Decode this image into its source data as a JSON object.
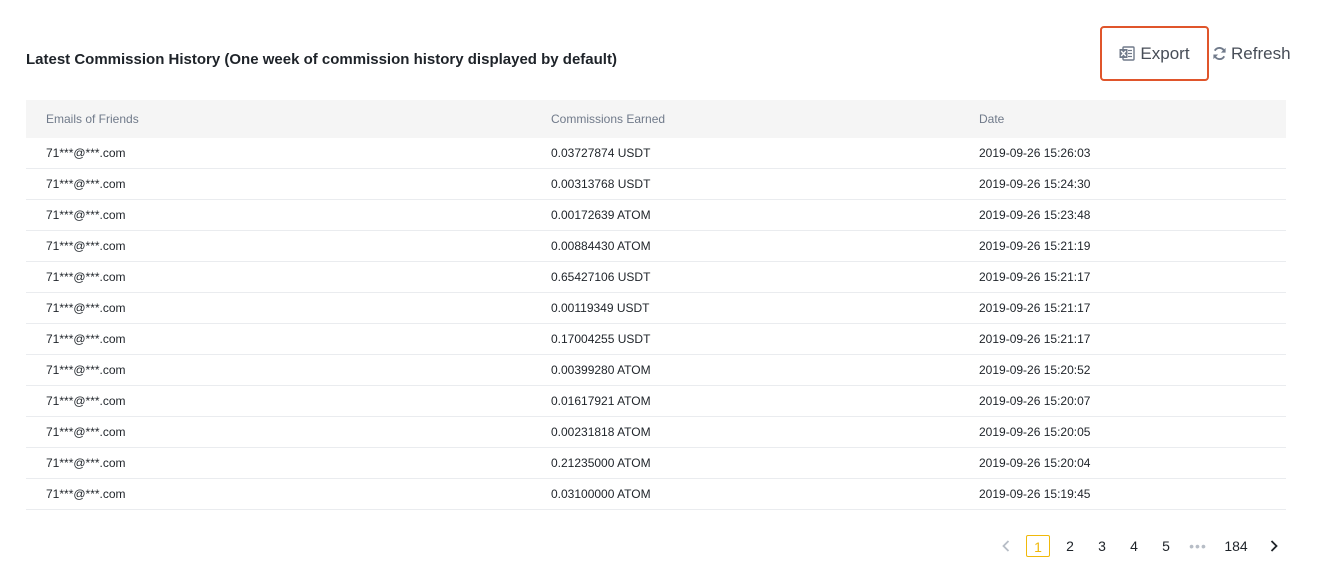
{
  "header": {
    "title": "Latest Commission History (One week of commission history displayed by default)",
    "export_label": "Export",
    "refresh_label": "Refresh"
  },
  "table": {
    "columns": [
      "Emails of Friends",
      "Commissions Earned",
      "Date"
    ],
    "rows": [
      [
        "71***@***.com",
        "0.03727874 USDT",
        "2019-09-26 15:26:03"
      ],
      [
        "71***@***.com",
        "0.00313768 USDT",
        "2019-09-26 15:24:30"
      ],
      [
        "71***@***.com",
        "0.00172639 ATOM",
        "2019-09-26 15:23:48"
      ],
      [
        "71***@***.com",
        "0.00884430 ATOM",
        "2019-09-26 15:21:19"
      ],
      [
        "71***@***.com",
        "0.65427106 USDT",
        "2019-09-26 15:21:17"
      ],
      [
        "71***@***.com",
        "0.00119349 USDT",
        "2019-09-26 15:21:17"
      ],
      [
        "71***@***.com",
        "0.17004255 USDT",
        "2019-09-26 15:21:17"
      ],
      [
        "71***@***.com",
        "0.00399280 ATOM",
        "2019-09-26 15:20:52"
      ],
      [
        "71***@***.com",
        "0.01617921 ATOM",
        "2019-09-26 15:20:07"
      ],
      [
        "71***@***.com",
        "0.00231818 ATOM",
        "2019-09-26 15:20:05"
      ],
      [
        "71***@***.com",
        "0.21235000 ATOM",
        "2019-09-26 15:20:04"
      ],
      [
        "71***@***.com",
        "0.03100000 ATOM",
        "2019-09-26 15:19:45"
      ]
    ]
  },
  "pagination": {
    "pages": [
      "1",
      "2",
      "3",
      "4",
      "5"
    ],
    "current": "1",
    "ellipsis": "•••",
    "last_page": "184"
  },
  "colors": {
    "accent": "#f0b90b",
    "highlight_border": "#e0552b",
    "header_bg": "#f5f5f5"
  },
  "icons": {
    "export": "excel-file-icon",
    "refresh": "refresh-icon",
    "prev": "chevron-left-icon",
    "next": "chevron-right-icon"
  }
}
